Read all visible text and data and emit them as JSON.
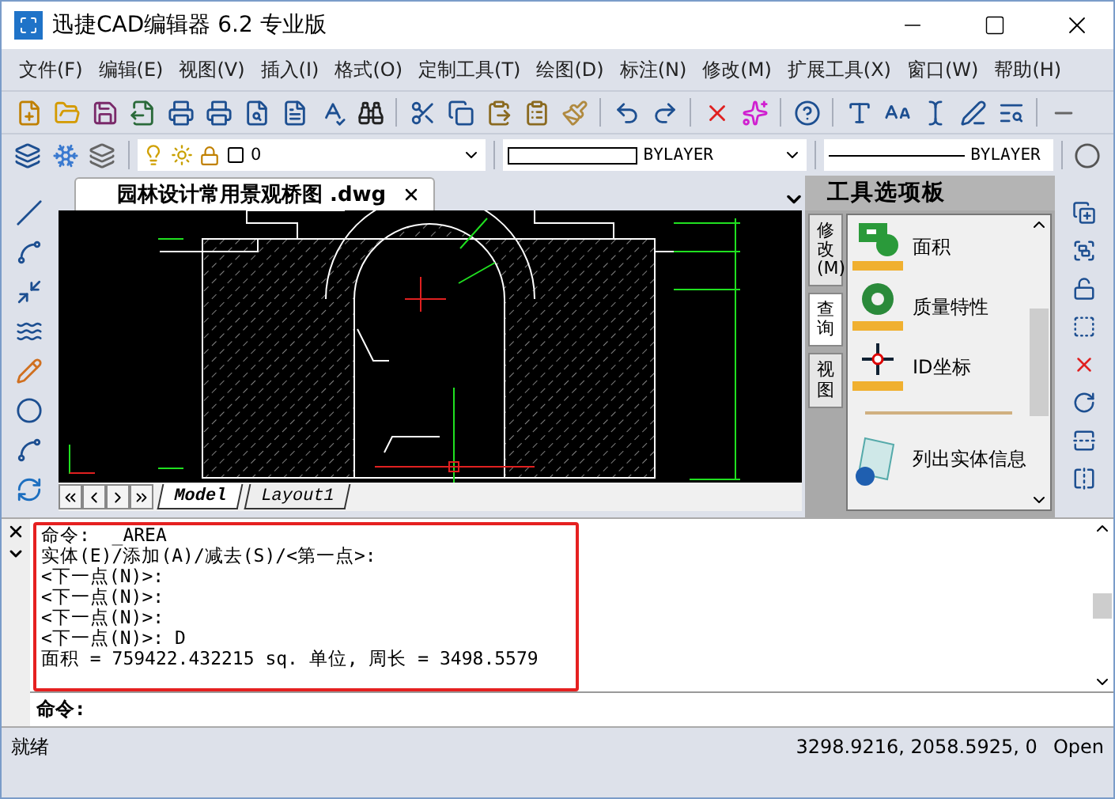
{
  "window": {
    "title": "迅捷CAD编辑器 6.2 专业版"
  },
  "menu": [
    "文件(F)",
    "编辑(E)",
    "视图(V)",
    "插入(I)",
    "格式(O)",
    "定制工具(T)",
    "绘图(D)",
    "标注(N)",
    "修改(M)",
    "扩展工具(X)",
    "窗口(W)",
    "帮助(H)"
  ],
  "layer_dropdown": {
    "value": "0"
  },
  "color_dropdown": {
    "value": "BYLAYER"
  },
  "linetype_dropdown": {
    "value": "BYLAYER"
  },
  "document_tab": {
    "label": "园林设计常用景观桥图 .dwg"
  },
  "layout_tabs": [
    {
      "label": "Model",
      "selected": true
    },
    {
      "label": "Layout1",
      "selected": false
    }
  ],
  "tool_palette": {
    "title": "工具选项板",
    "tabs": [
      {
        "label": "修改(M)",
        "selected": false
      },
      {
        "label": "查询",
        "selected": true
      },
      {
        "label": "视图",
        "selected": false
      }
    ],
    "items": [
      {
        "label": "面积",
        "kind": "area"
      },
      {
        "label": "质量特性",
        "kind": "mass"
      },
      {
        "label": "ID坐标",
        "kind": "id"
      },
      {
        "kind": "separator"
      },
      {
        "label": "列出实体信息",
        "kind": "list"
      }
    ]
  },
  "command_history": [
    "命令:  _AREA",
    "实体(E)/添加(A)/减去(S)/<第一点>:",
    "<下一点(N)>:",
    "<下一点(N)>:",
    "<下一点(N)>:",
    "<下一点(N)>: D",
    "面积 = 759422.432215 sq. 单位, 周长 = 3498.5579"
  ],
  "command_prompt": {
    "label": "命令:"
  },
  "status_bar": {
    "status": "就绪",
    "coordinates": "3298.9216, 2058.5925, 0",
    "mode": "Open"
  }
}
